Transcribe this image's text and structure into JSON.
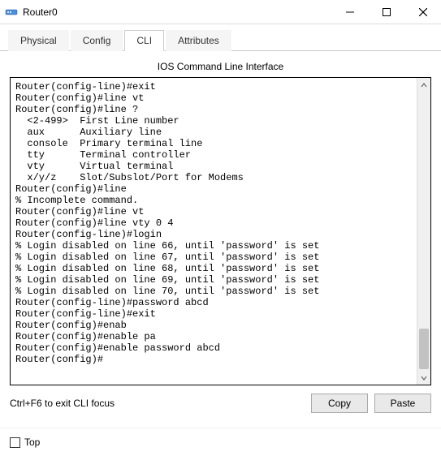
{
  "window": {
    "title": "Router0"
  },
  "tabs": {
    "physical": "Physical",
    "config": "Config",
    "cli": "CLI",
    "attributes": "Attributes"
  },
  "panel": {
    "title": "IOS Command Line Interface"
  },
  "terminal": {
    "lines": [
      "Router(config-line)#exit",
      "Router(config)#line vt",
      "Router(config)#line ?",
      "  <2-499>  First Line number",
      "  aux      Auxiliary line",
      "  console  Primary terminal line",
      "  tty      Terminal controller",
      "  vty      Virtual terminal",
      "  x/y/z    Slot/Subslot/Port for Modems",
      "Router(config)#line",
      "% Incomplete command.",
      "Router(config)#line vt",
      "Router(config)#line vty 0 4",
      "Router(config-line)#login",
      "% Login disabled on line 66, until 'password' is set",
      "% Login disabled on line 67, until 'password' is set",
      "% Login disabled on line 68, until 'password' is set",
      "% Login disabled on line 69, until 'password' is set",
      "% Login disabled on line 70, until 'password' is set",
      "Router(config-line)#password abcd",
      "Router(config-line)#exit",
      "Router(config)#enab",
      "Router(config)#enable pa",
      "Router(config)#enable password abcd",
      "Router(config)#"
    ]
  },
  "controls": {
    "hint": "Ctrl+F6 to exit CLI focus",
    "copy": "Copy",
    "paste": "Paste"
  },
  "footer": {
    "top": "Top",
    "checked": false
  }
}
